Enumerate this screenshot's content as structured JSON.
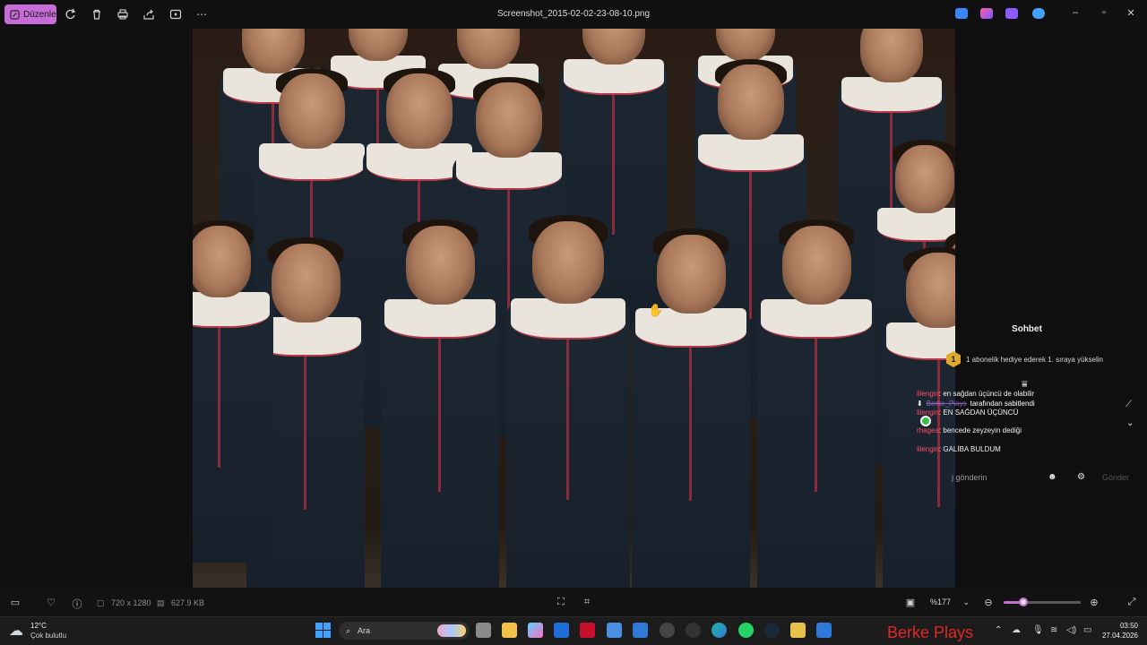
{
  "toolbar": {
    "edit_label": "Düzenle",
    "file_name": "Screenshot_2015-02-02-23-08-10.png",
    "actions": [
      "rotate-icon",
      "delete-icon",
      "print-icon",
      "share-icon",
      "slideshow-icon",
      "more-icon"
    ]
  },
  "chat": {
    "title": "Sohbet",
    "gift_badge": "1",
    "gift_text": "1 abonelik hediye ederek 1. sıraya yükselin",
    "messages": [
      {
        "user": "lilengin",
        "text": ": en sağdan üçüncü de olabilir"
      },
      {
        "user": "lilengin",
        "text": ": EN SAĞDAN ÜÇÜNCÜ"
      },
      {
        "user": "rhagea",
        "text": ": bencede zeyzeyin dediği"
      },
      {
        "user": "lilengin",
        "text": ": GALİBA BULDUM"
      }
    ],
    "pinned_by_user": "Berke_Plays",
    "pinned_text": "tarafından sabitlendi",
    "input_placeholder": "j gönderin",
    "send_label": "Gönder"
  },
  "status": {
    "dimensions": "720 x 1280",
    "file_size": "627.9 KB",
    "zoom": "%177",
    "zoom_fraction": 0.26
  },
  "taskbar": {
    "weather_temp": "12°C",
    "weather_desc": "Çok bulutlu",
    "search_label": "Ara",
    "brand": "Berke Plays",
    "time": "03:50",
    "date": "27.04.2026"
  },
  "colors": {
    "accent": "#c86dd7",
    "chat_user": "#ff4d6b",
    "brand_red": "#e02828"
  }
}
